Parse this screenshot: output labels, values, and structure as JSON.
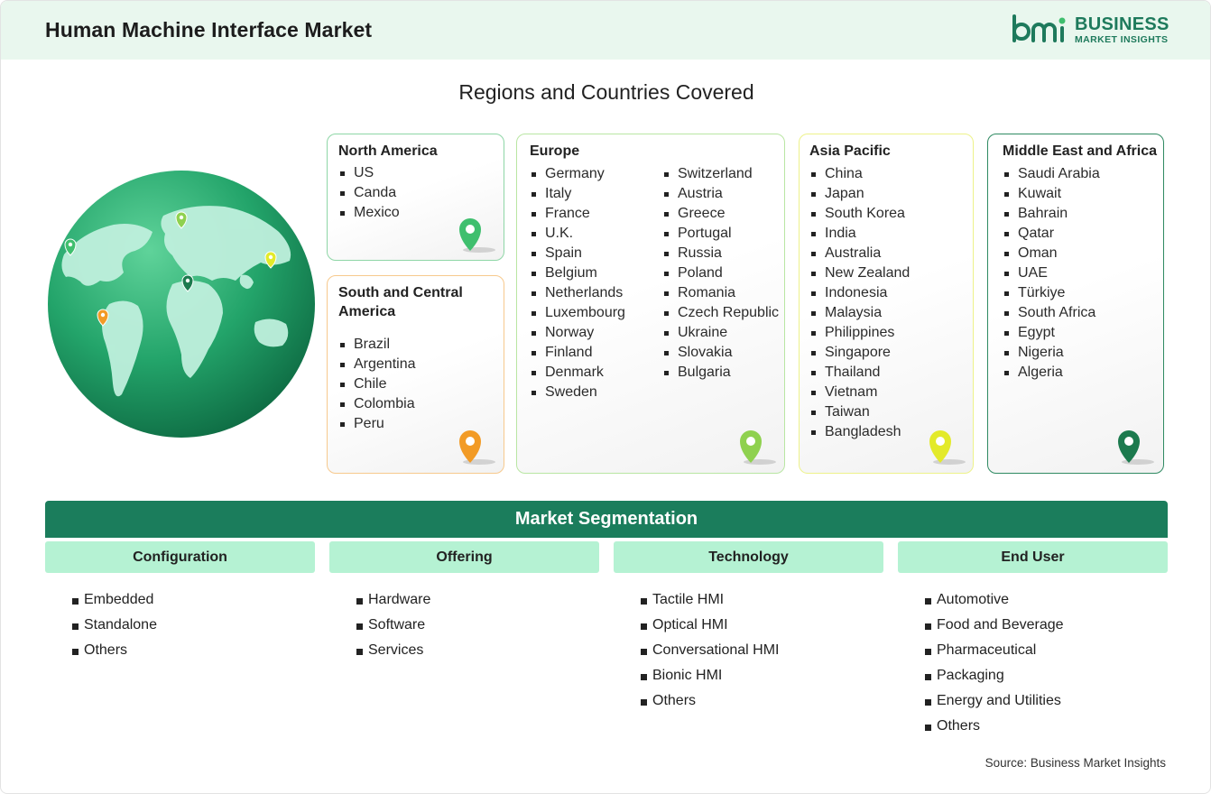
{
  "header": {
    "title": "Human Machine Interface Market",
    "logo_business": "BUSINESS",
    "logo_sub": "MARKET INSIGHTS"
  },
  "section_title": "Regions and Countries Covered",
  "regions": {
    "north_america": {
      "title": "North America",
      "countries": [
        "US",
        "Canda",
        "Mexico"
      ],
      "pin_color": "#3fbf6e"
    },
    "south_central_america": {
      "title": "South and Central America",
      "countries": [
        "Brazil",
        "Argentina",
        "Chile",
        "Colombia",
        "Peru"
      ],
      "pin_color": "#f29b26"
    },
    "europe": {
      "title": "Europe",
      "countries_col1": [
        "Germany",
        "Italy",
        "France",
        "U.K.",
        "Spain",
        "Belgium",
        "Netherlands",
        "Luxembourg",
        "Norway",
        "Finland",
        "Denmark",
        "Sweden"
      ],
      "countries_col2": [
        "Switzerland",
        "Austria",
        "Greece",
        "Portugal",
        "Russia",
        "Poland",
        "Romania",
        "Czech Republic",
        "Ukraine",
        "Slovakia",
        "Bulgaria"
      ],
      "pin_color": "#8fd14f"
    },
    "asia_pacific": {
      "title": "Asia Pacific",
      "countries": [
        "China",
        "Japan",
        "South Korea",
        "India",
        "Australia",
        "New Zealand",
        "Indonesia",
        "Malaysia",
        "Philippines",
        "Singapore",
        "Thailand",
        "Vietnam",
        "Taiwan",
        "Bangladesh"
      ],
      "pin_color": "#e3ea2a"
    },
    "middle_east_africa": {
      "title": "Middle East and Africa",
      "countries": [
        "Saudi Arabia",
        "Kuwait",
        "Bahrain",
        "Qatar",
        "Oman",
        "UAE",
        "Türkiye",
        "South Africa",
        "Egypt",
        "Nigeria",
        "Algeria"
      ],
      "pin_color": "#1c7a4e"
    }
  },
  "segmentation": {
    "title": "Market Segmentation",
    "configuration": {
      "title": "Configuration",
      "items": [
        "Embedded",
        "Standalone",
        "Others"
      ]
    },
    "offering": {
      "title": "Offering",
      "items": [
        "Hardware",
        "Software",
        "Services"
      ]
    },
    "technology": {
      "title": "Technology",
      "items": [
        "Tactile HMI",
        "Optical HMI",
        "Conversational HMI",
        "Bionic HMI",
        "Others"
      ]
    },
    "end_user": {
      "title": "End User",
      "items": [
        "Automotive",
        "Food and Beverage",
        "Pharmaceutical",
        "Packaging",
        "Energy and Utilities",
        "Others"
      ]
    }
  },
  "source": "Source: Business Market Insights",
  "colors": {
    "header_bg": "#e9f7ee",
    "brand_green": "#1e7a5c",
    "segmentation_bar": "#1b7d5c",
    "segment_header": "#b5f2d3"
  }
}
